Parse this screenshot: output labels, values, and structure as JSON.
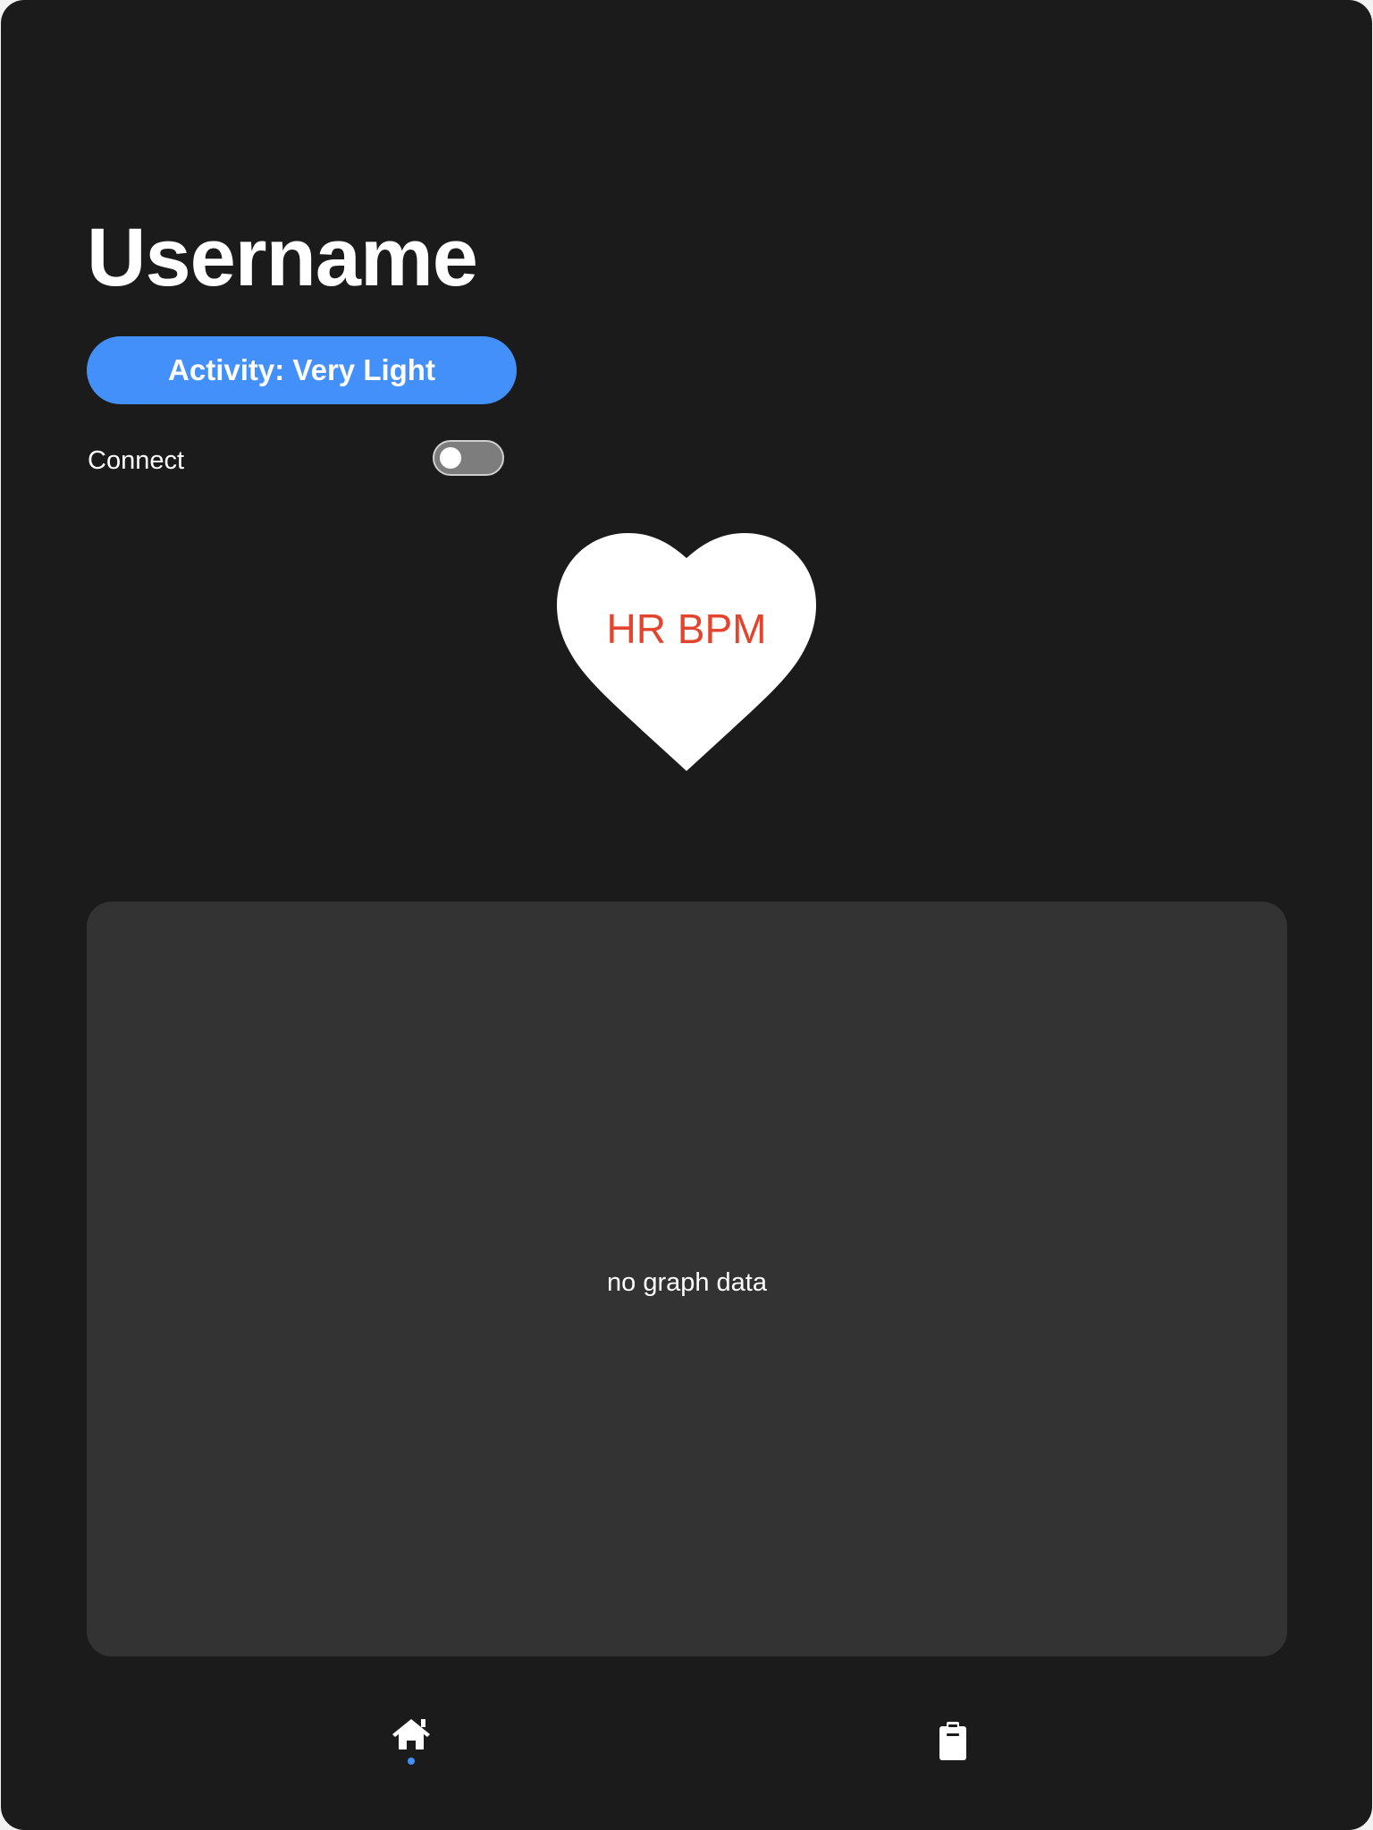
{
  "profile": {
    "username": "Username"
  },
  "activity": {
    "label": "Activity: Very Light",
    "color": "#4490fb"
  },
  "connect": {
    "label": "Connect",
    "enabled": false
  },
  "heart_rate": {
    "label": "HR BPM",
    "label_color": "#e2442d",
    "icon": "heart-icon"
  },
  "graph": {
    "empty_message": "no graph data"
  },
  "tabbar": {
    "tabs": [
      {
        "id": "home",
        "icon": "home-icon",
        "active": true
      },
      {
        "id": "logs",
        "icon": "clipboard-icon",
        "active": false
      }
    ],
    "active_indicator_color": "#4490fb"
  },
  "colors": {
    "background": "#1b1b1b",
    "card": "#333333",
    "text": "#ffffff"
  }
}
